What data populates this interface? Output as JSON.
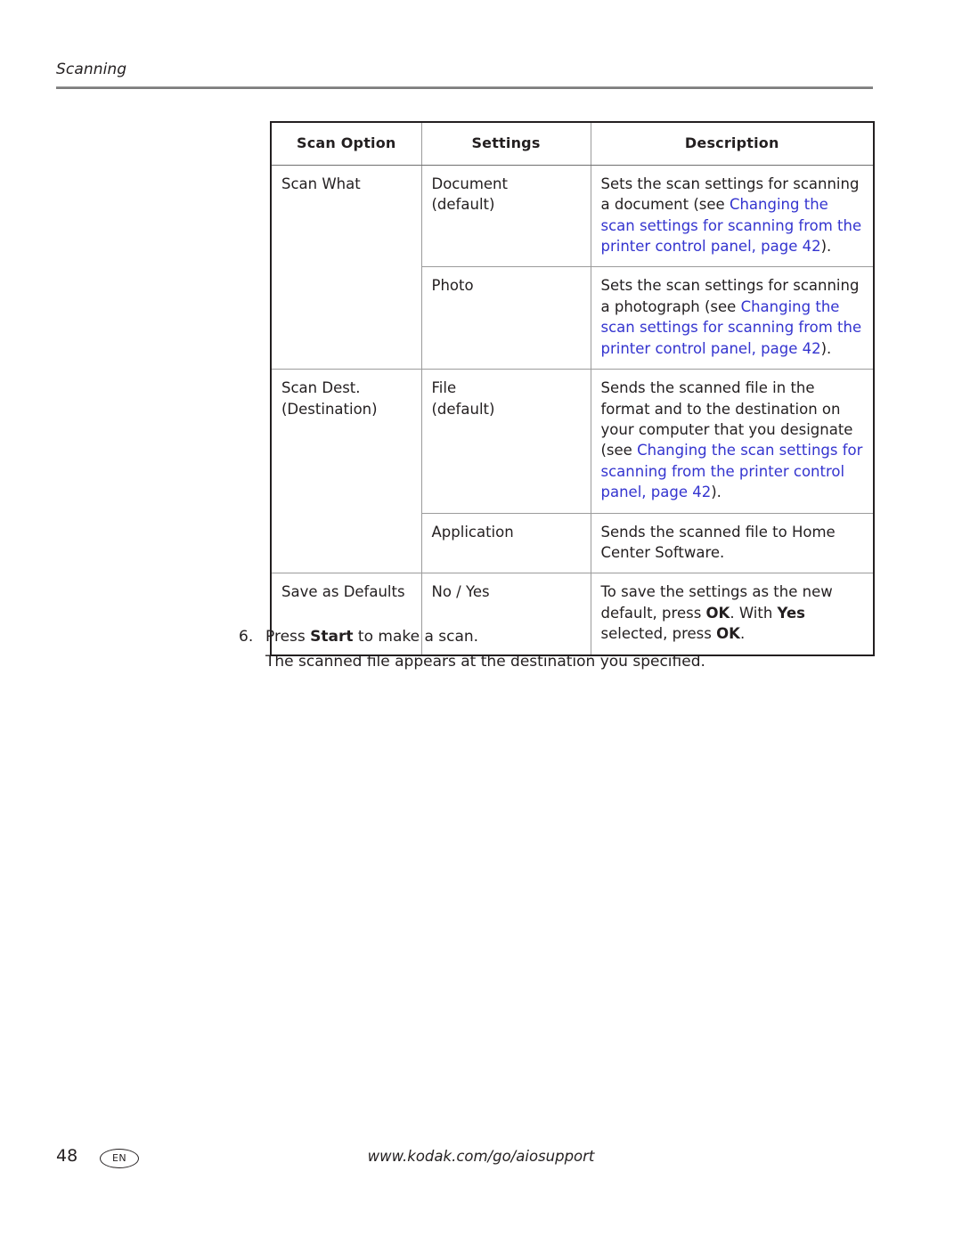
{
  "running_head": "Scanning",
  "table": {
    "headers": [
      "Scan Option",
      "Settings",
      "Description"
    ],
    "rows": [
      {
        "option": "Scan What",
        "settings": "Document\n(default)",
        "desc_plain_1": "Sets the scan settings for scanning a document (see ",
        "desc_link": "Changing the scan settings for scanning from the printer control panel, page 42",
        "desc_plain_2": ")."
      },
      {
        "option": "",
        "settings": "Photo",
        "desc_plain_1": "Sets the scan settings for scanning a photograph (see ",
        "desc_link": "Changing the scan settings for scanning from the printer control panel, page 42",
        "desc_plain_2": ")."
      },
      {
        "option": "Scan Dest.\n(Destination)",
        "settings": "File\n(default)",
        "desc_plain_1": "Sends the scanned file in the format and to the destination on your computer that you designate (see ",
        "desc_link": "Changing the scan settings for scanning from the printer control panel, page 42",
        "desc_plain_2": ")."
      },
      {
        "option": "",
        "settings": "Application",
        "desc_plain_1": "Sends the scanned file to Home Center Software.",
        "desc_link": "",
        "desc_plain_2": ""
      },
      {
        "option": "Save as Defaults",
        "settings": "No / Yes",
        "desc_parts": [
          {
            "t": "To save the settings as the new default, press ",
            "b": false
          },
          {
            "t": "OK",
            "b": true
          },
          {
            "t": ". With ",
            "b": false
          },
          {
            "t": "Yes",
            "b": true
          },
          {
            "t": " selected, press ",
            "b": false
          },
          {
            "t": "OK",
            "b": true
          },
          {
            "t": ".",
            "b": false
          }
        ]
      }
    ]
  },
  "step": {
    "number": "6.",
    "text_before": "Press ",
    "text_bold": "Start",
    "text_after": " to make a scan.",
    "follow_up": "The scanned file appears at the destination you specified."
  },
  "footer": {
    "page_number": "48",
    "language": "EN",
    "url": "www.kodak.com/go/aiosupport"
  },
  "colors": {
    "link": "#3434cf",
    "text": "#231f20",
    "rule": "#7d7d7d",
    "border": "#9b9b9b"
  }
}
